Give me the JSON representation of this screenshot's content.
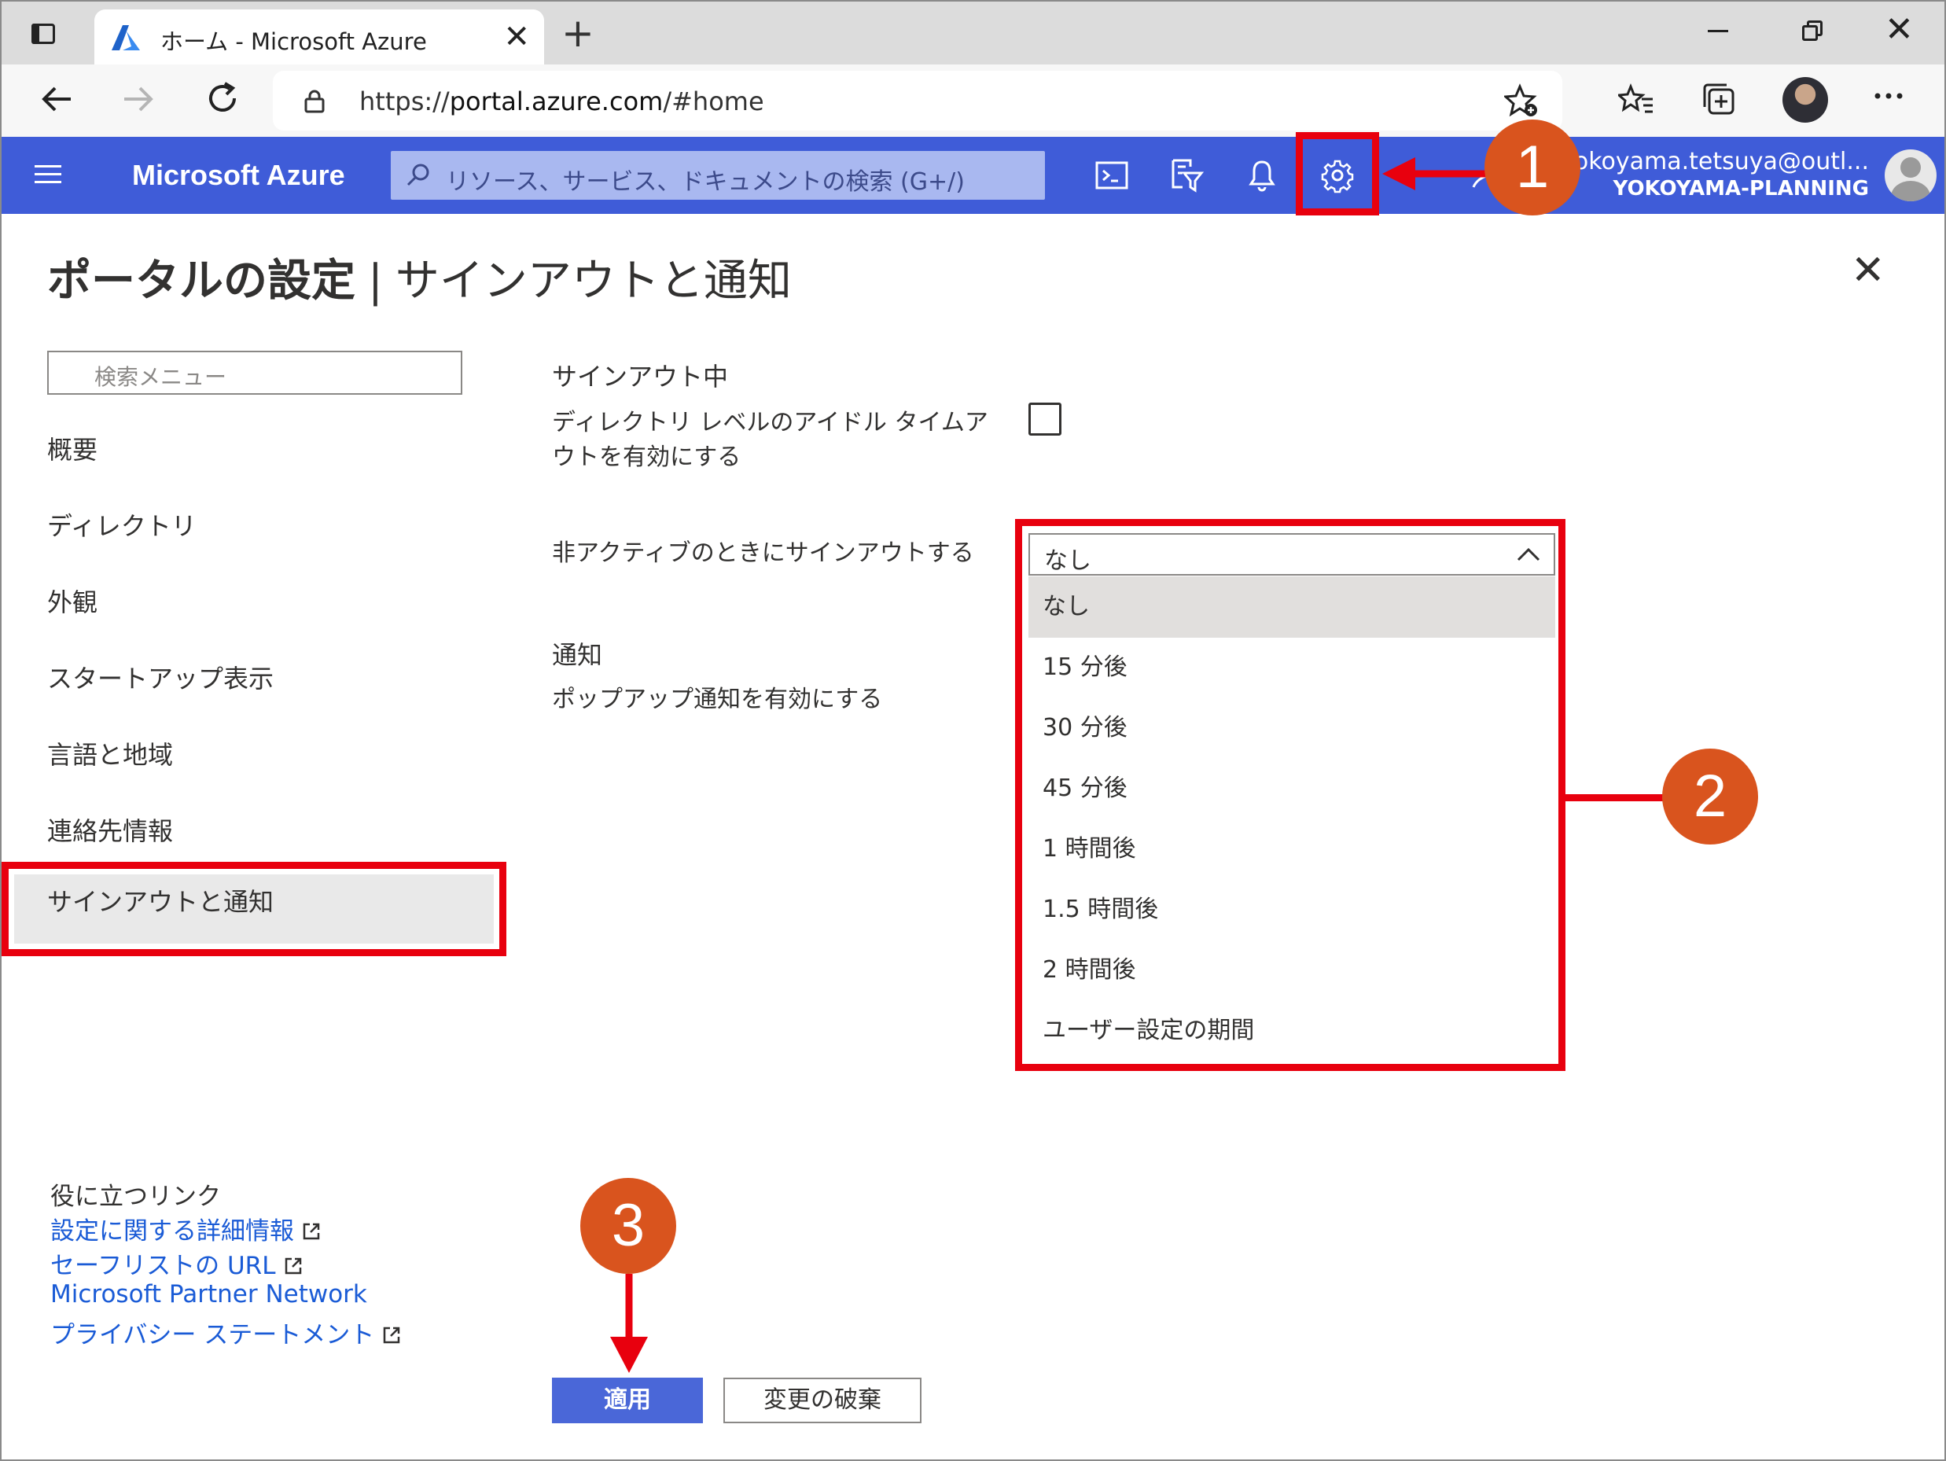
{
  "browser": {
    "tab_title": "ホーム - Microsoft Azure",
    "tab_close": "✕",
    "new_tab": "+",
    "url_prefix": "https://",
    "url_host": "portal.azure.com",
    "url_path": "/#home",
    "icons": [
      "tab-actions-icon",
      "back-icon",
      "forward-icon",
      "refresh-icon",
      "lock-icon",
      "add-favorite-icon",
      "favorites-icon",
      "collections-icon",
      "profile-icon",
      "more-icon"
    ]
  },
  "azure": {
    "brand": "Microsoft Azure",
    "search_placeholder": "リソース、サービス、ドキュメントの検索 (G+/)",
    "user_email": "yokoyama.tetsuya@outl...",
    "user_org": "YOKOYAMA-PLANNING",
    "accent_color": "#3f5cd8"
  },
  "page": {
    "title_main": "ポータルの設定",
    "title_separator": "|",
    "title_sub": "サインアウトと通知",
    "close": "✕"
  },
  "menu": {
    "search_placeholder": "検索メニュー",
    "items": [
      {
        "label": "概要"
      },
      {
        "label": "ディレクトリ"
      },
      {
        "label": "外観"
      },
      {
        "label": "スタートアップ表示"
      },
      {
        "label": "言語と地域"
      },
      {
        "label": "連絡先情報"
      },
      {
        "label": "サインアウトと通知",
        "selected": true
      }
    ]
  },
  "links": {
    "title": "役に立つリンク",
    "items": [
      "設定に関する詳細情報",
      "セーフリストの URL",
      "Microsoft Partner Network",
      "プライバシー ステートメント"
    ]
  },
  "settings": {
    "signout_heading": "サインアウト中",
    "idle_timeout_label": "ディレクトリ レベルのアイドル タイムアウトを有効にする",
    "idle_timeout_checked": false,
    "inactive_signout_label": "非アクティブのときにサインアウトする",
    "inactive_signout_value": "なし",
    "inactive_signout_options": [
      "なし",
      "15 分後",
      "30 分後",
      "45 分後",
      "1 時間後",
      "1.5 時間後",
      "2 時間後",
      "ユーザー設定の期間"
    ],
    "notifications_heading": "通知",
    "popup_label": "ポップアップ通知を有効にする"
  },
  "buttons": {
    "apply": "適用",
    "discard": "変更の破棄"
  },
  "annotations": {
    "step1": "1",
    "step2": "2",
    "step3": "3",
    "highlight_color": "#e8000e",
    "badge_color": "#d9541e"
  }
}
